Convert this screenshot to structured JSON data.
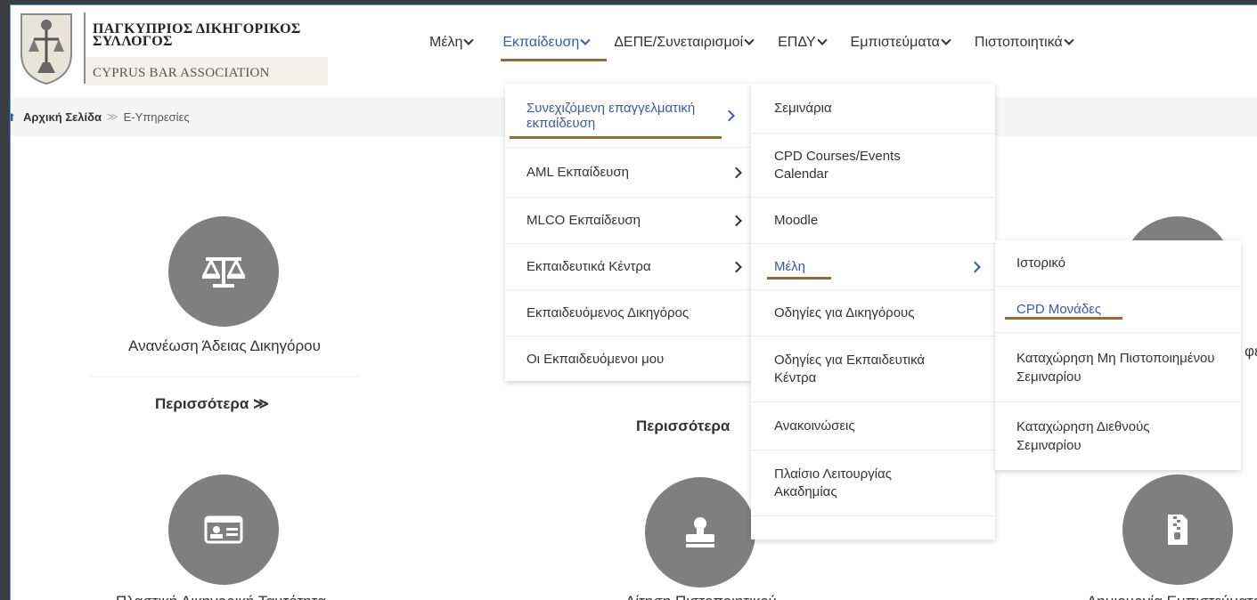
{
  "logo": {
    "greek_line1": "ΠΑΓΚΥΠΡΙΟΣ ΔΙΚΗΓΟΡΙΚΟΣ",
    "greek_line2": "ΣΥΛΛΟΓΟΣ",
    "english": "CYPRUS BAR ASSOCIATION"
  },
  "nav": {
    "items": [
      {
        "label": "Μέλη"
      },
      {
        "label": "Εκπαίδευση"
      },
      {
        "label": "ΔΕΠΕ/Συνεταιρισμοί"
      },
      {
        "label": "ΕΠΔΥ"
      },
      {
        "label": "Εμπιστεύματα"
      },
      {
        "label": "Πιστοποιητικά"
      }
    ]
  },
  "breadcrumb": {
    "home": "Αρχική Σελίδα",
    "sep": "≫",
    "current": "Ε-Υπηρεσίες"
  },
  "services": {
    "s1_title": "Ανανέωση Άδειας Δικηγόρου",
    "more": "Περισσότερα",
    "more_arrows": "≫",
    "s2_more": "Περισσότερα",
    "s3_title_fragment": "φε",
    "s4_title": "Πλαστική Δικηγορική Ταυτότητα",
    "s5_title": "Αίτηση Πιστοποιητικού",
    "s6_title": "Δημιουργία Εμπιστεύματος"
  },
  "menu_level1": {
    "items": [
      {
        "label": "Συνεχιζόμενη επαγγελματική εκπαίδευση"
      },
      {
        "label": "AML Εκπαίδευση"
      },
      {
        "label": "MLCO Εκπαίδευση"
      },
      {
        "label": "Εκπαιδευτικά Κέντρα"
      },
      {
        "label": "Εκπαιδευόμενος Δικηγόρος"
      },
      {
        "label": "Οι Εκπαιδευόμενοι μου"
      }
    ]
  },
  "menu_level2": {
    "items": [
      {
        "label": "Σεμινάρια"
      },
      {
        "label": "CPD Courses/Events Calendar"
      },
      {
        "label": "Moodle"
      },
      {
        "label": "Μέλη"
      },
      {
        "label": "Οδηγίες για Δικηγόρους"
      },
      {
        "label": "Οδηγίες για Εκπαιδευτικά Κέντρα"
      },
      {
        "label": "Ανακοινώσεις"
      },
      {
        "label": "Πλαίσιο Λειτουργίας Ακαδημίας"
      }
    ]
  },
  "menu_level3": {
    "items": [
      {
        "label": "Ιστορικό"
      },
      {
        "label": "CPD Μονάδες"
      },
      {
        "label": "Καταχώρηση Μη Πιστοποιημένου Σεμιναρίου"
      },
      {
        "label": "Καταχώρηση Διεθνούς Σεμιναρίου"
      }
    ]
  },
  "colors": {
    "accent_blue": "#3d5aa0",
    "underline_gold": "#8a6d3b",
    "circle_grey": "#7f7f7f"
  }
}
